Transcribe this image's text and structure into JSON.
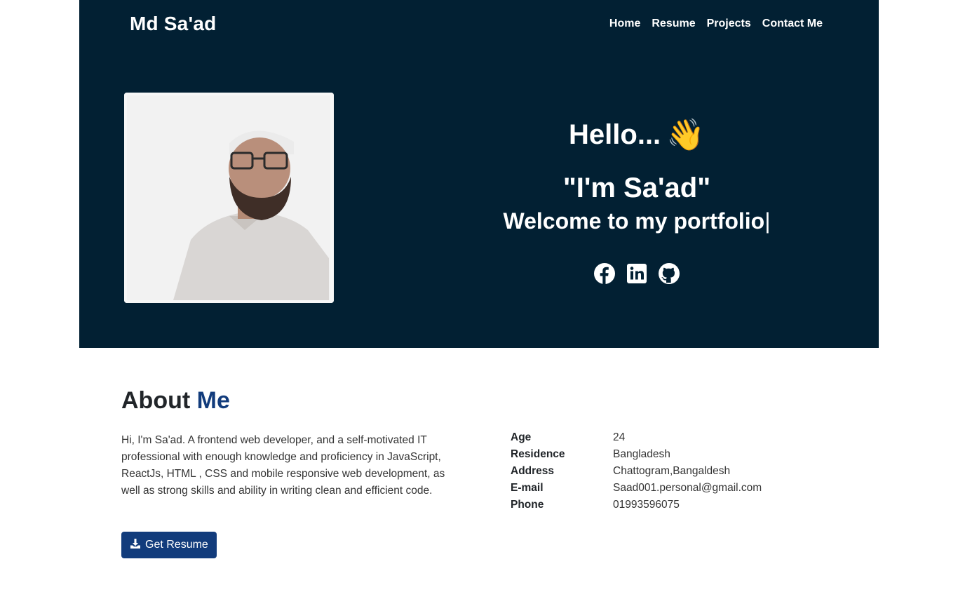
{
  "nav": {
    "brand": "Md Sa'ad",
    "links": [
      "Home",
      "Resume",
      "Projects",
      "Contact Me"
    ]
  },
  "hero": {
    "greeting": "Hello...",
    "wave_emoji": "👋",
    "name_line": "\"I'm Sa'ad\"",
    "welcome_line": "Welcome to my portfolio",
    "cursor": "|",
    "socials": [
      "facebook-icon",
      "linkedin-icon",
      "github-icon"
    ]
  },
  "about": {
    "title_main": "About",
    "title_accent": "Me",
    "description": "Hi, I'm Sa'ad. A frontend web developer, and a self-motivated IT professional with enough knowledge and proficiency in JavaScript, ReactJs, HTML , CSS and mobile responsive web development, as well as strong skills and ability in writing clean and efficient code.",
    "resume_button": "Get Resume",
    "info": [
      {
        "label": "Age",
        "value": "24"
      },
      {
        "label": "Residence",
        "value": "Bangladesh"
      },
      {
        "label": "Address",
        "value": "Chattogram,Bangaldesh"
      },
      {
        "label": "E-mail",
        "value": "Saad001.personal@gmail.com"
      },
      {
        "label": "Phone",
        "value": "01993596075"
      }
    ]
  },
  "colors": {
    "hero_bg": "#022033",
    "accent": "#123c7c"
  }
}
